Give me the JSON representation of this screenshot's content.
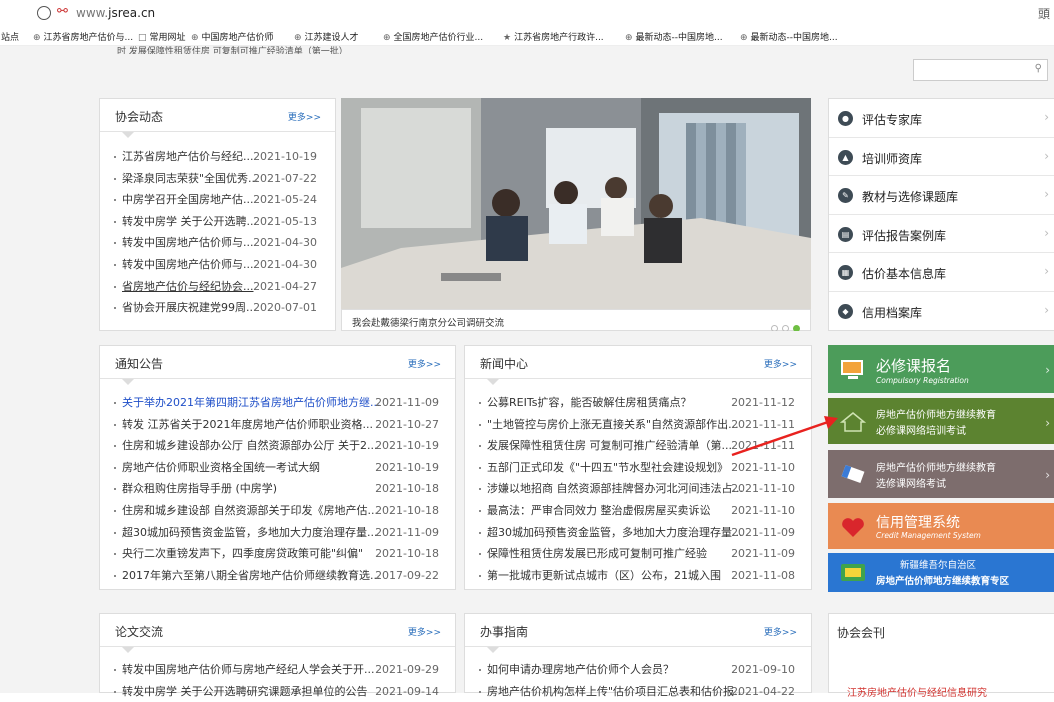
{
  "browser": {
    "url_prefix": "www.",
    "url_host": "jsrea.cn",
    "right_glyph": "頭",
    "bookmarks": [
      {
        "label": "站点",
        "icon": "none"
      },
      {
        "label": "江苏省房地产估价与...",
        "icon": "globe-icon"
      },
      {
        "label": "常用网址",
        "icon": "folder-icon"
      },
      {
        "label": "中国房地产估价师",
        "icon": "globe-icon"
      },
      {
        "label": "江苏建设人才",
        "icon": "globe-icon"
      },
      {
        "label": "全国房地产估价行业...",
        "icon": "globe-icon"
      },
      {
        "label": "江苏省房地产行政许...",
        "icon": "emblem-icon"
      },
      {
        "label": "最新动态--中国房地...",
        "icon": "globe-icon"
      },
      {
        "label": "最新动态--中国房地...",
        "icon": "globe-icon"
      }
    ]
  },
  "topline": "时 发展保障性租赁住房 可复制可推广经验清单（第一批）",
  "association_news": {
    "title": "协会动态",
    "more": "更多>>",
    "items": [
      {
        "t": "江苏省房地产估价与经纪...",
        "d": "2021-10-19"
      },
      {
        "t": "梁泽泉同志荣获\"全国优秀...",
        "d": "2021-07-22"
      },
      {
        "t": "中房学召开全国房地产估...",
        "d": "2021-05-24"
      },
      {
        "t": "转发中房学 关于公开选聘...",
        "d": "2021-05-13"
      },
      {
        "t": "转发中国房地产估价师与...",
        "d": "2021-04-30"
      },
      {
        "t": "转发中国房地产估价师与...",
        "d": "2021-04-30"
      },
      {
        "t": "省房地产估价与经纪协会...",
        "d": "2021-04-27"
      },
      {
        "t": "省协会开展庆祝建党99周...",
        "d": "2020-07-01"
      }
    ]
  },
  "photo": {
    "caption": "我会赴戴德梁行南京分公司调研交流"
  },
  "right_links": [
    {
      "label": "评估专家库",
      "icon": "chat-icon"
    },
    {
      "label": "培训师资库",
      "icon": "trainer-icon"
    },
    {
      "label": "教材与选修课题库",
      "icon": "book-icon"
    },
    {
      "label": "评估报告案例库",
      "icon": "report-icon"
    },
    {
      "label": "估价基本信息库",
      "icon": "database-icon"
    },
    {
      "label": "信用档案库",
      "icon": "credit-icon"
    }
  ],
  "notices": {
    "title": "通知公告",
    "more": "更多>>",
    "items": [
      {
        "t": "关于举办2021年第四期江苏省房地产估价师地方继...",
        "d": "2021-11-09",
        "hl": true
      },
      {
        "t": "转发 江苏省关于2021年度房地产估价师职业资格...",
        "d": "2021-10-27"
      },
      {
        "t": "住房和城乡建设部办公厅 自然资源部办公厅 关于2...",
        "d": "2021-10-19"
      },
      {
        "t": "房地产估价师职业资格全国统一考试大纲",
        "d": "2021-10-19"
      },
      {
        "t": "群众租购住房指导手册 (中房学)",
        "d": "2021-10-18"
      },
      {
        "t": "住房和城乡建设部 自然资源部关于印发《房地产估...",
        "d": "2021-10-18"
      },
      {
        "t": "超30城加码预售资金监管，多地加大力度治理存量...",
        "d": "2021-11-09"
      },
      {
        "t": "央行二次重镑发声下，四季度房贷政策可能\"纠偏\"",
        "d": "2021-10-18"
      },
      {
        "t": "2017年第六至第八期全省房地产估价师继续教育选...",
        "d": "2017-09-22"
      }
    ]
  },
  "news_center": {
    "title": "新闻中心",
    "more": "更多>>",
    "items": [
      {
        "t": "公募REITs扩容，能否破解住房租赁痛点？",
        "d": "2021-11-12"
      },
      {
        "t": "\"土地管控与房价上涨无直接关系\"自然资源部作出...",
        "d": "2021-11-11"
      },
      {
        "t": "发展保障性租赁住房 可复制可推广经验清单（第...",
        "d": "2021-11-11"
      },
      {
        "t": "五部门正式印发《\"十四五\"节水型社会建设规划》",
        "d": "2021-11-10"
      },
      {
        "t": "涉嫌以地招商 自然资源部挂牌督办河北河间违法占...",
        "d": "2021-11-10"
      },
      {
        "t": "最高法：严审合同效力 整治虚假房屋买卖诉讼",
        "d": "2021-11-10"
      },
      {
        "t": "超30城加码预售资金监管，多地加大力度治理存量...",
        "d": "2021-11-09"
      },
      {
        "t": "保障性租赁住房发展已形成可复制可推广经验",
        "d": "2021-11-09"
      },
      {
        "t": "第一批城市更新试点城市（区）公布，21城入围",
        "d": "2021-11-08"
      }
    ]
  },
  "banners": {
    "required": {
      "title": "必修课报名",
      "sub": "Compulsory Registration",
      "color": "#4c9c5a"
    },
    "required_exam": {
      "line1": "房地产估价师地方继续教育",
      "line2": "必修课网络培训考试",
      "color": "#5c8330"
    },
    "elective_exam": {
      "line1": "房地产估价师地方继续教育",
      "line2": "选修课网络考试",
      "color": "#7d6d6d"
    },
    "credit": {
      "title": "信用管理系统",
      "sub": "Credit Management System",
      "color": "#e98a52"
    },
    "xinjiang": {
      "line1": "新疆维吾尔自治区",
      "line2": "房地产估价师地方继续教育专区",
      "color": "#2a76d2"
    }
  },
  "papers": {
    "title": "论文交流",
    "more": "更多>>",
    "items": [
      {
        "t": "转发中国房地产估价师与房地产经纪人学会关于开...",
        "d": "2021-09-29"
      },
      {
        "t": "转发中房学 关于公开选聘研究课题承担单位的公告",
        "d": "2021-09-14"
      }
    ]
  },
  "guide": {
    "title": "办事指南",
    "more": "更多>>",
    "items": [
      {
        "t": "如何申请办理房地产估价师个人会员？",
        "d": "2021-09-10"
      },
      {
        "t": "房地产估价机构怎样上传\"估价项目汇总表和估价报...",
        "d": "2021-04-22"
      }
    ]
  },
  "journal": {
    "title": "协会会刊",
    "cover_text": "江苏房地产估价与经纪信息研究"
  }
}
